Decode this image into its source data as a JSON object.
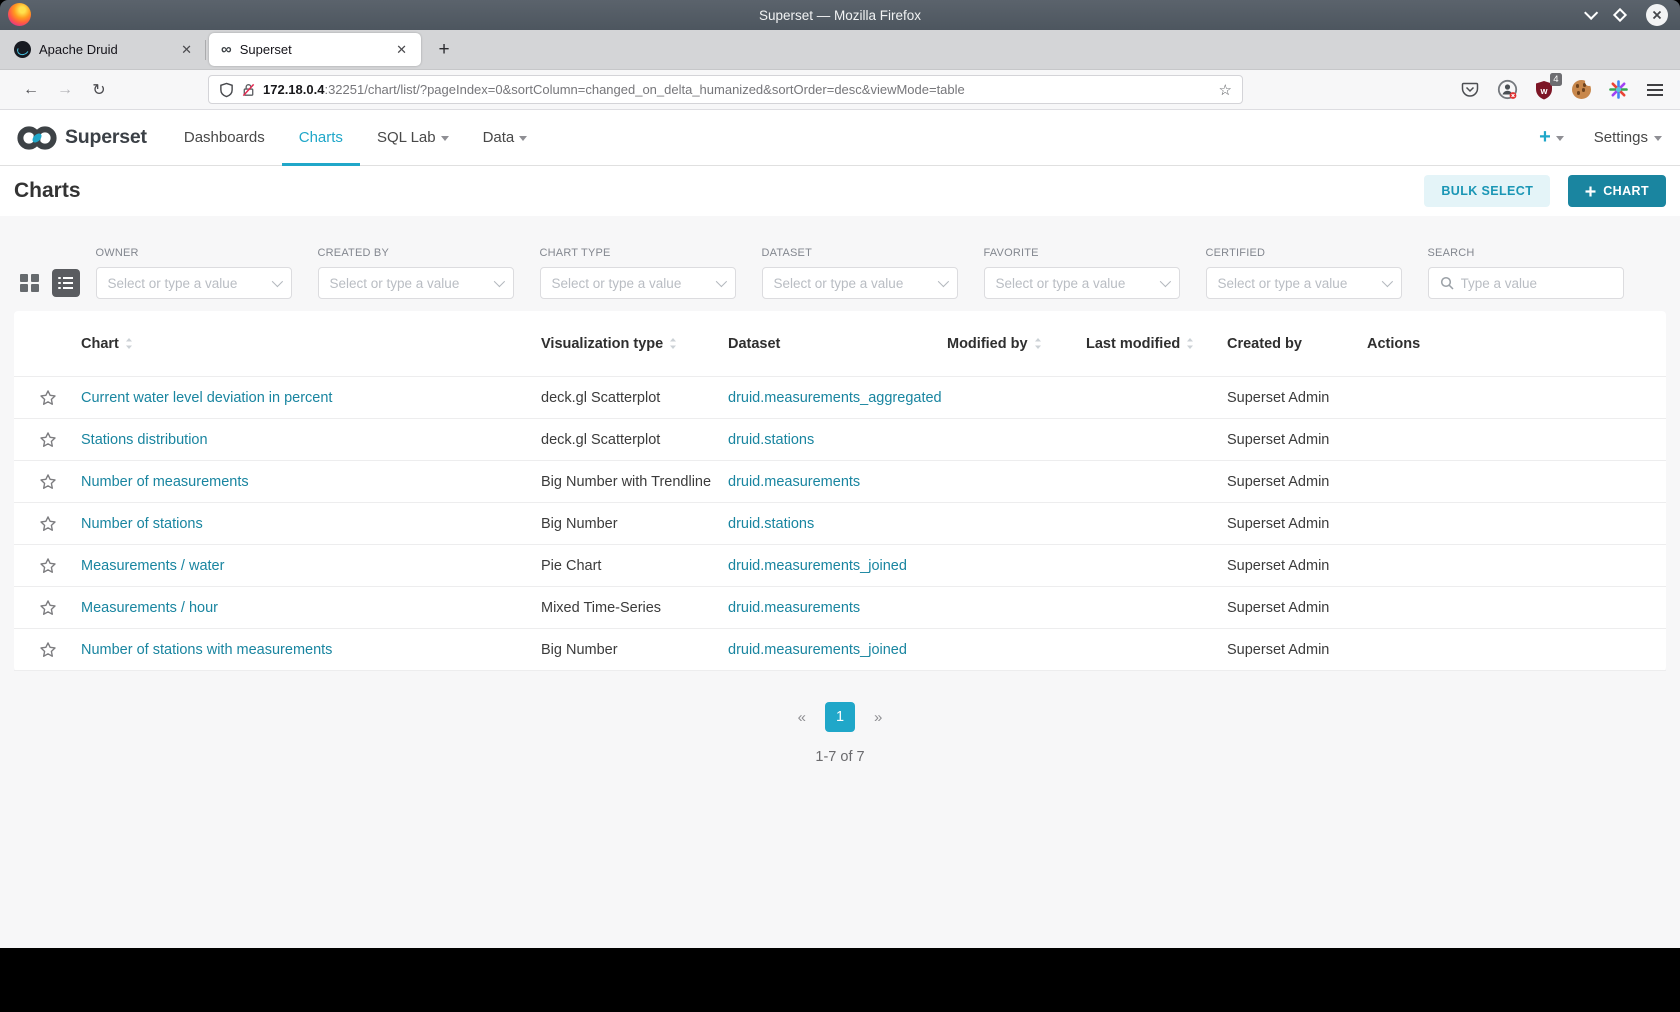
{
  "window": {
    "title": "Superset — Mozilla Firefox"
  },
  "browser": {
    "tabs": [
      {
        "label": "Apache Druid",
        "close_label": "✕",
        "active": false
      },
      {
        "label": "Superset",
        "close_label": "✕",
        "active": true
      }
    ],
    "new_tab_label": "+",
    "back_icon": "←",
    "forward_icon": "→",
    "reload_icon": "↻",
    "bookmark_star": "☆",
    "url": {
      "host": "172.18.0.4",
      "rest": ":32251/chart/list/?pageIndex=0&sortColumn=changed_on_delta_humanized&sortOrder=desc&viewMode=table"
    },
    "extension_badge": "4"
  },
  "navbar": {
    "brand": "Superset",
    "items": [
      {
        "label": "Dashboards",
        "active": false,
        "caret": false
      },
      {
        "label": "Charts",
        "active": true,
        "caret": false
      },
      {
        "label": "SQL Lab",
        "active": false,
        "caret": true
      },
      {
        "label": "Data",
        "active": false,
        "caret": true
      }
    ],
    "plus_label": "+",
    "settings_label": "Settings"
  },
  "page": {
    "title": "Charts",
    "bulk_select_label": "BULK SELECT",
    "add_chart_label": "CHART"
  },
  "filters": {
    "select_placeholder": "Select or type a value",
    "search_placeholder": "Type a value",
    "search_label": "SEARCH",
    "items": [
      {
        "label": "OWNER"
      },
      {
        "label": "CREATED BY"
      },
      {
        "label": "CHART TYPE"
      },
      {
        "label": "DATASET"
      },
      {
        "label": "FAVORITE"
      },
      {
        "label": "CERTIFIED"
      }
    ]
  },
  "table": {
    "columns": [
      {
        "label": "Chart",
        "sortable": true
      },
      {
        "label": "Visualization type",
        "sortable": true
      },
      {
        "label": "Dataset",
        "sortable": false
      },
      {
        "label": "Modified by",
        "sortable": true
      },
      {
        "label": "Last modified",
        "sortable": true
      },
      {
        "label": "Created by",
        "sortable": false
      },
      {
        "label": "Actions",
        "sortable": false
      }
    ],
    "rows": [
      {
        "chart": "Current water level deviation in percent",
        "viz_type": "deck.gl Scatterplot",
        "dataset": "druid.measurements_aggregated",
        "modified_by": "",
        "last_modified": "",
        "created_by": "Superset Admin"
      },
      {
        "chart": "Stations distribution",
        "viz_type": "deck.gl Scatterplot",
        "dataset": "druid.stations",
        "modified_by": "",
        "last_modified": "",
        "created_by": "Superset Admin"
      },
      {
        "chart": "Number of measurements",
        "viz_type": "Big Number with Trendline",
        "dataset": "druid.measurements",
        "modified_by": "",
        "last_modified": "",
        "created_by": "Superset Admin"
      },
      {
        "chart": "Number of stations",
        "viz_type": "Big Number",
        "dataset": "druid.stations",
        "modified_by": "",
        "last_modified": "",
        "created_by": "Superset Admin"
      },
      {
        "chart": "Measurements / water",
        "viz_type": "Pie Chart",
        "dataset": "druid.measurements_joined",
        "modified_by": "",
        "last_modified": "",
        "created_by": "Superset Admin"
      },
      {
        "chart": "Measurements / hour",
        "viz_type": "Mixed Time-Series",
        "dataset": "druid.measurements",
        "modified_by": "",
        "last_modified": "",
        "created_by": "Superset Admin"
      },
      {
        "chart": "Number of stations with measurements",
        "viz_type": "Big Number",
        "dataset": "druid.measurements_joined",
        "modified_by": "",
        "last_modified": "",
        "created_by": "Superset Admin"
      }
    ]
  },
  "pagination": {
    "prev": "«",
    "page": "1",
    "next": "»",
    "summary": "1-7 of 7"
  },
  "colors": {
    "accent": "#20a7c9",
    "accent-dark": "#1a85a0",
    "link": "#1985a0",
    "body-gray": "#f7f7f8"
  }
}
